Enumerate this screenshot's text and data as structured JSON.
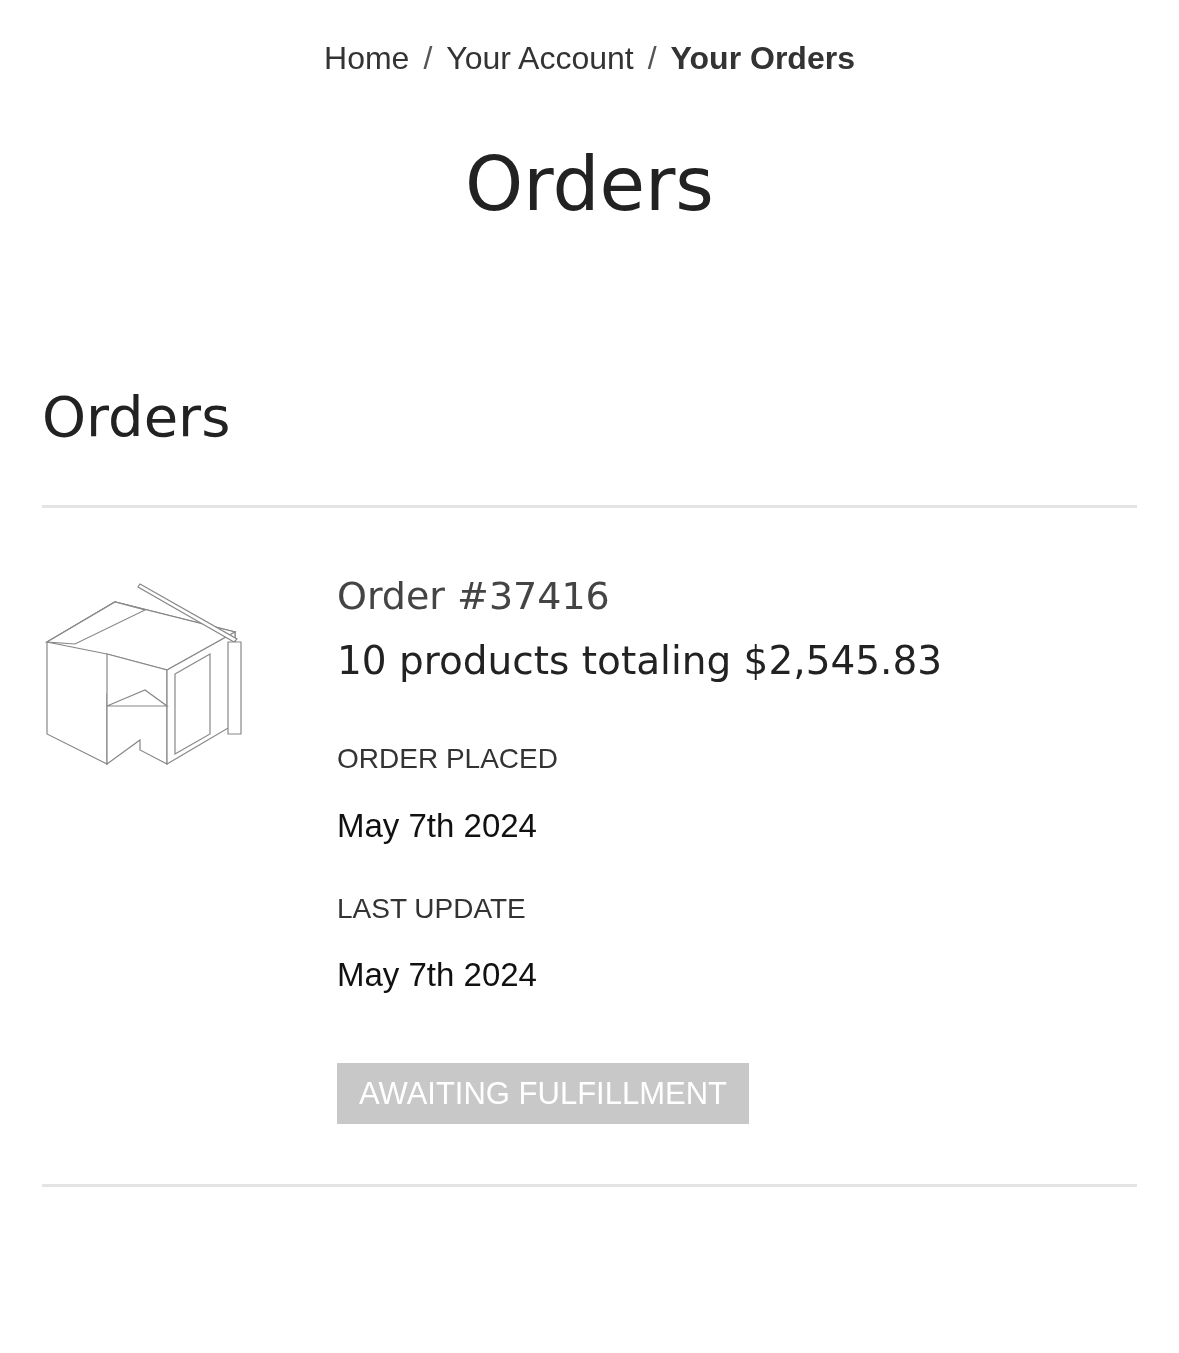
{
  "breadcrumb": [
    {
      "label": "Home",
      "current": false
    },
    {
      "separator": "/",
      "label": "Your Account",
      "current": false
    },
    {
      "separator": "/",
      "label": "Your Orders",
      "current": true
    }
  ],
  "page_title": "Orders",
  "section_title": "Orders",
  "orders": [
    {
      "image": {
        "kind": "picture"
      },
      "title": "Order #37416",
      "summary": "10 products totaling $2,545.83",
      "fields": [
        {
          "label": "ORDER PLACED",
          "value": "May 7th 2024"
        },
        {
          "label": "LAST UPDATE",
          "value": "May 7th 2024"
        }
      ],
      "status": "AWAITING FULFILLMENT"
    }
  ]
}
